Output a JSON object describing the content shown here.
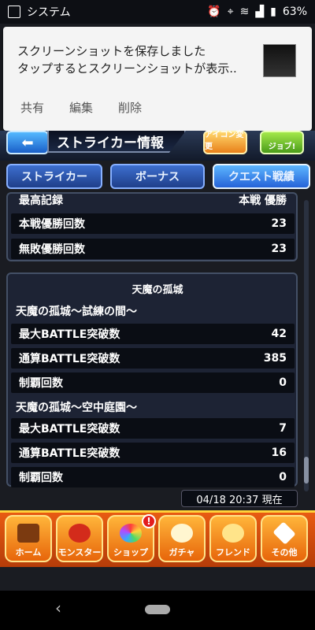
{
  "statusbar": {
    "title": "システム",
    "battery": "63%"
  },
  "notification": {
    "line1": "スクリーンショットを保存しました",
    "line2": "タップするとスクリーンショットが表示..",
    "actions": [
      "共有",
      "編集",
      "削除"
    ]
  },
  "header": {
    "title": "ストライカー情報",
    "icon1_label": "アイコン変更",
    "icon2_label": "ジョブ!"
  },
  "tabs": [
    "ストライカー",
    "ボーナス",
    "クエスト戦績"
  ],
  "top_rows": {
    "partial_label": "最高記録",
    "partial_value": "本戦 優勝",
    "rows": [
      {
        "label": "本戦優勝回数",
        "value": "23"
      },
      {
        "label": "無敗優勝回数",
        "value": "23"
      }
    ]
  },
  "section": {
    "title": "天魔の孤城",
    "groups": [
      {
        "heading": "天魔の孤城〜試練の間〜",
        "rows": [
          {
            "label": "最大BATTLE突破数",
            "value": "42"
          },
          {
            "label": "通算BATTLE突破数",
            "value": "385"
          },
          {
            "label": "制覇回数",
            "value": "0"
          }
        ]
      },
      {
        "heading": "天魔の孤城〜空中庭園〜",
        "rows": [
          {
            "label": "最大BATTLE突破数",
            "value": "7"
          },
          {
            "label": "通算BATTLE突破数",
            "value": "16"
          },
          {
            "label": "制覇回数",
            "value": "0"
          }
        ]
      }
    ]
  },
  "timestamp": "04/18 20:37 現在",
  "bottom_nav": [
    "ホーム",
    "モンスター",
    "ショップ",
    "ガチャ",
    "フレンド",
    "その他"
  ],
  "shop_badge": "!",
  "android_nav": {
    "back": "‹"
  },
  "colors": {
    "nav_orange": "#e85b12",
    "tab_active": "#2563d8",
    "row_bg": "#0a0d14"
  }
}
